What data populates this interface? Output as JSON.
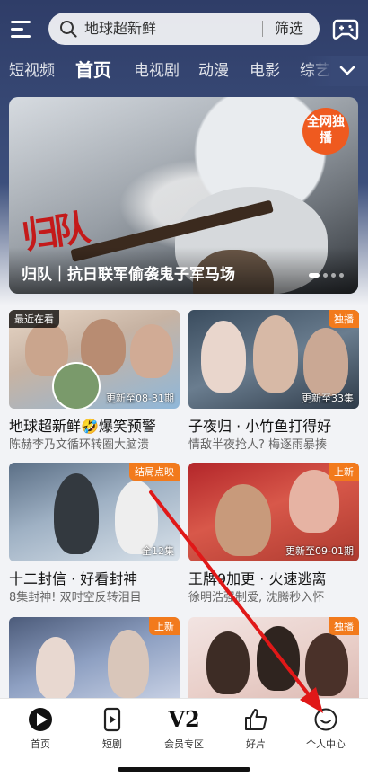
{
  "search": {
    "query": "地球超新鲜",
    "filter_label": "筛选"
  },
  "tabs": [
    {
      "label": "短视频"
    },
    {
      "label": "首页"
    },
    {
      "label": "电视剧"
    },
    {
      "label": "动漫"
    },
    {
      "label": "电影"
    },
    {
      "label": "综艺"
    }
  ],
  "banner": {
    "title": "归队｜抗日联军偷袭鬼子军马场",
    "overlay_text": "归队",
    "badge": "全网独播"
  },
  "cards": [
    {
      "tag_left": "最近在看",
      "tag_right": "",
      "episode": "更新至08-31期",
      "title": "地球超新鲜🤣爆笑预警",
      "subtitle": "陈赫李乃文循环转圈大脑溃"
    },
    {
      "tag_left": "",
      "tag_right": "独播",
      "episode": "更新至33集",
      "title": "子夜归 · 小竹鱼打得好",
      "subtitle": "情敌半夜抢人? 梅逐雨暴揍"
    },
    {
      "tag_left": "",
      "tag_right": "结局点映",
      "episode": "全12集",
      "title": "十二封信 · 好看封神",
      "subtitle": "8集封神! 双时空反转泪目"
    },
    {
      "tag_left": "",
      "tag_right": "上新",
      "episode": "更新至09-01期",
      "title": "王牌9加更 · 火速逃离",
      "subtitle": "徐明浩强制爱, 沈腾秒入怀"
    },
    {
      "tag_left": "",
      "tag_right": "上新",
      "episode": "",
      "title": "",
      "subtitle": ""
    },
    {
      "tag_left": "",
      "tag_right": "独播",
      "episode": "",
      "title": "",
      "subtitle": ""
    }
  ],
  "bottom_nav": [
    {
      "label": "首页",
      "icon": "play-logo-icon"
    },
    {
      "label": "短剧",
      "icon": "short-drama-icon"
    },
    {
      "label": "会员专区",
      "icon": "v2-icon",
      "icon_text": "V2"
    },
    {
      "label": "好片",
      "icon": "thumbs-up-icon"
    },
    {
      "label": "个人中心",
      "icon": "smiley-icon"
    }
  ],
  "colors": {
    "accent": "#f27a1c",
    "header_bg": "#3c4f7c",
    "annotation_arrow": "#e01818"
  }
}
